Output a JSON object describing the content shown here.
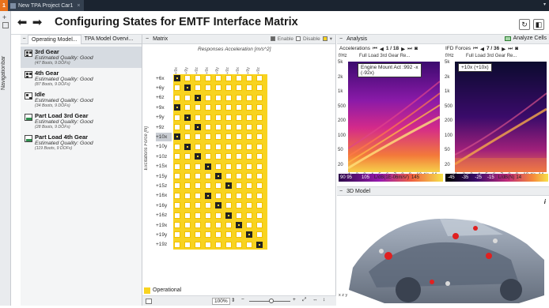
{
  "titlebar": {
    "badge": "1",
    "tab_label": "New TPA Project Car1",
    "close": "×"
  },
  "nav_rail": {
    "label": "Navigationbar",
    "add": "+"
  },
  "header": {
    "title": "Configuring States for EMTF Interface Matrix",
    "back": "⬅",
    "forward": "➡",
    "refresh": "↻",
    "layout": "◧"
  },
  "left": {
    "minus": "−",
    "tabs": [
      "Operating Model...",
      "TPA Model Overvi..."
    ],
    "items": [
      {
        "title": "3rd Gear",
        "quality": "Estimated Quality: Good",
        "detail": "(47 Boots, 9 DOFs)",
        "selected": true
      },
      {
        "title": "4th Gear",
        "quality": "Estimated Quality: Good",
        "detail": "(87 Boots, 9 DOFs)"
      },
      {
        "title": "Idle",
        "quality": "Estimated Quality: Good",
        "detail": "(34 Boots, 9 DOFs)"
      },
      {
        "title": "Part Load 3rd Gear",
        "quality": "Estimated Quality: Good",
        "detail": "(28 Boots, 9 DOFs)"
      },
      {
        "title": "Part Load 4th Gear",
        "quality": "Estimated Quality: Good",
        "detail": "(119 Boots, 9 DOFs)"
      }
    ]
  },
  "matrix": {
    "title": "Matrix",
    "enable": "Enable",
    "disable": "Disable",
    "response_title": "Responses Acceleration [m/s^2]",
    "force_title": "Excitations Force [N]",
    "columns": [
      "+9x",
      "+9y",
      "+9z",
      "+9x",
      "+9y",
      "+9z",
      "+9x",
      "+9y",
      "+9z"
    ],
    "rows": [
      "+6x",
      "+6y",
      "+6z",
      "+9x",
      "+9y",
      "+9z",
      "+10x",
      "+10y",
      "+10z",
      "+15x",
      "+15y",
      "+15z",
      "+16x",
      "+16y",
      "+16z",
      "+19x",
      "+19y",
      "+19z"
    ],
    "selected_cells": [
      [
        0,
        0
      ],
      [
        1,
        1
      ],
      [
        2,
        2
      ],
      [
        3,
        0
      ],
      [
        4,
        1
      ],
      [
        5,
        2
      ],
      [
        6,
        0
      ],
      [
        7,
        1
      ],
      [
        8,
        2
      ],
      [
        9,
        3
      ],
      [
        10,
        4
      ],
      [
        11,
        5
      ],
      [
        12,
        3
      ],
      [
        13,
        4
      ],
      [
        14,
        5
      ],
      [
        15,
        6
      ],
      [
        16,
        7
      ],
      [
        17,
        8
      ]
    ],
    "highlight_row": "+10x",
    "legend": "Operational",
    "zoom": "100%",
    "colors": {
      "operational": "#f8d320",
      "selected": "#222222"
    }
  },
  "analysis": {
    "title": "Analysis",
    "analyze_btn": "Analyze Cells",
    "left_plot": {
      "type_label": "Accelerations",
      "nav": "1 / 18",
      "unit": "f/Hz",
      "title": "Full Load 3rd Gear Re...",
      "channel": "Engine Mount Act :992 -x",
      "channel_sub": "(-92x)",
      "yticks": [
        "5k",
        "2k",
        "1k",
        "500",
        "200",
        "100",
        "50",
        "20"
      ],
      "xticks": [
        "1",
        "2",
        "3",
        "4",
        "5",
        "6",
        "7",
        "8",
        "9",
        "10",
        "t/s",
        "14"
      ],
      "cbar": [
        "90 95",
        "105",
        "L/dB(1E-06m/s²)",
        "145"
      ]
    },
    "right_plot": {
      "type_label": "IFD Forces",
      "nav": "7 / 36",
      "unit": "f/Hz",
      "title": "Full Load 3rd Gear Re...",
      "channel": "+10x (+10x)",
      "yticks": [
        "5k",
        "2k",
        "1k",
        "500",
        "200",
        "100",
        "50",
        "20"
      ],
      "xticks": [
        "1",
        "2",
        "3",
        "4",
        "5",
        "6",
        "7",
        "8",
        "9",
        "10",
        "t/s",
        "14"
      ],
      "cbar": [
        "-45",
        "-35",
        "-25",
        "-15",
        "L/dB(N)",
        "14"
      ]
    }
  },
  "model3d": {
    "title": "3D Model",
    "axis": "x  z  y",
    "info": "i"
  }
}
